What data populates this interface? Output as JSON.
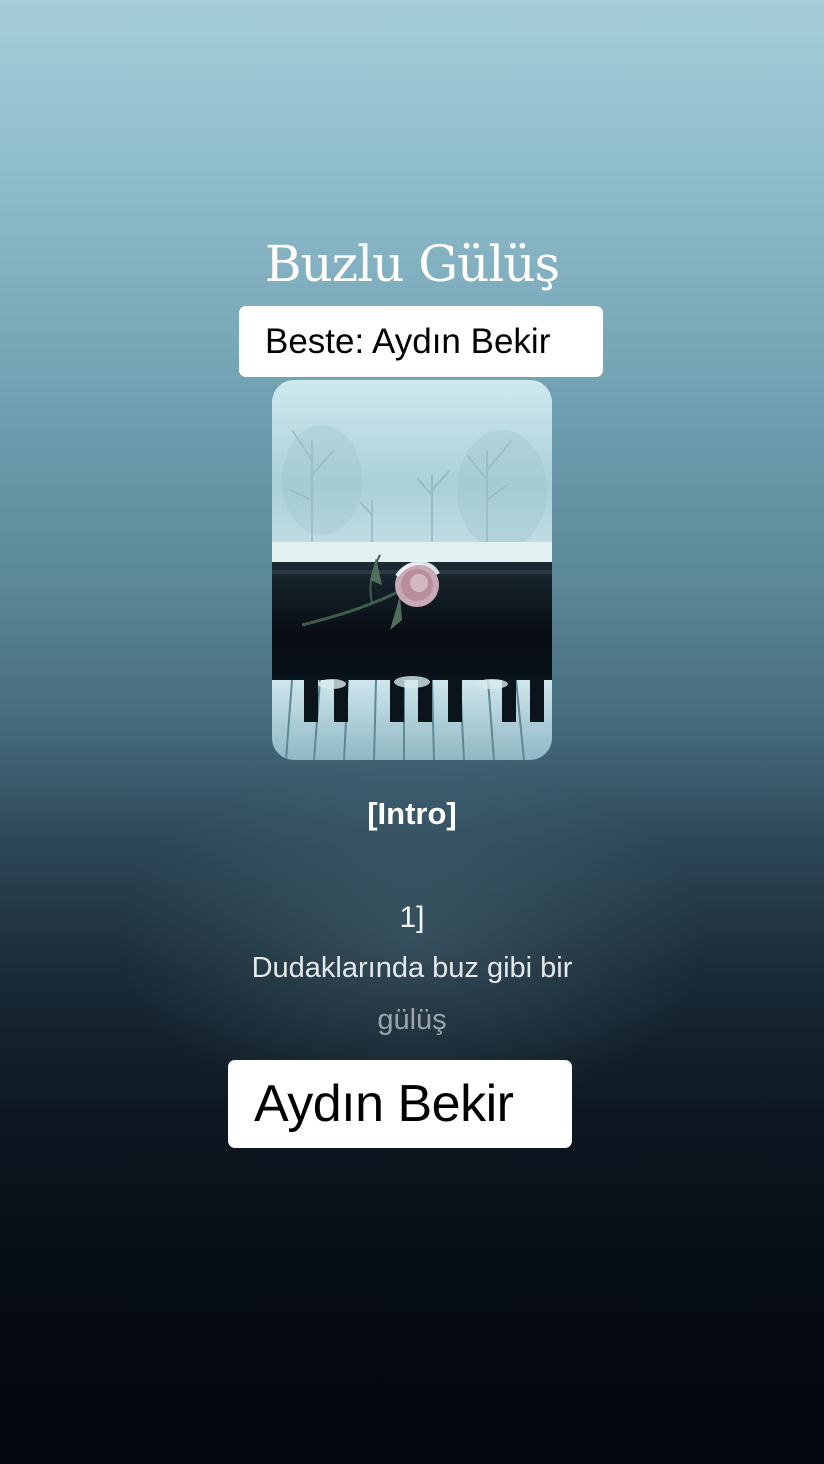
{
  "song": {
    "title": "Buzlu Gülüş",
    "composer_label": "Beste: Aydın Bekir",
    "cover_icon": "snowy-piano-rose-image"
  },
  "lyrics": {
    "section": "[Intro]",
    "verse_marker": "1]",
    "line1": "Dudaklarında buz gibi bir",
    "line2": "gülüş"
  },
  "artist": {
    "name": "Aydın Bekir"
  },
  "colors": {
    "background_top": "#a4cdd8",
    "background_bottom": "#03070d",
    "label_box": "#ffffff",
    "label_text": "#000000",
    "title_text": "#ffffff"
  }
}
